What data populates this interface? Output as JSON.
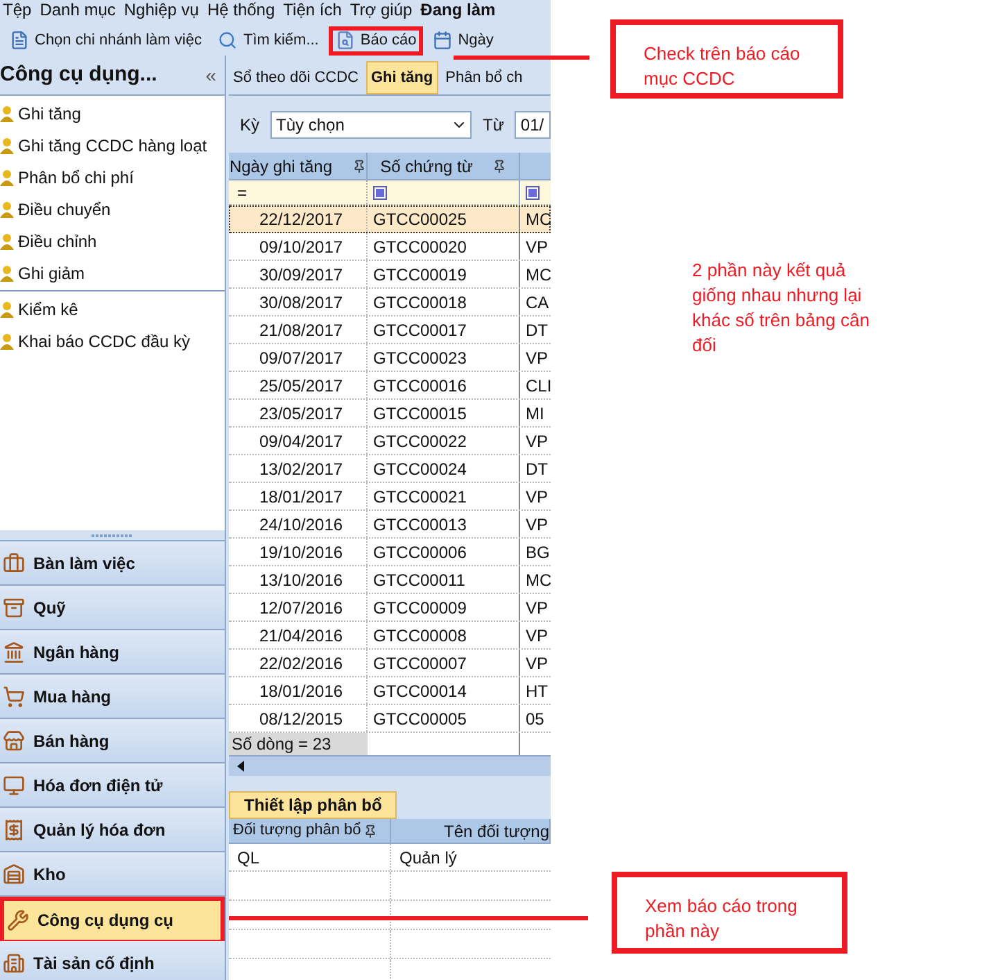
{
  "menu": [
    {
      "label": "Tệp",
      "bold": false
    },
    {
      "label": "Danh mục",
      "bold": false
    },
    {
      "label": "Nghiệp vụ",
      "bold": false
    },
    {
      "label": "Hệ thống",
      "bold": false
    },
    {
      "label": "Tiện ích",
      "bold": false
    },
    {
      "label": "Trợ giúp",
      "bold": false
    },
    {
      "label": "Đang làm",
      "bold": true
    }
  ],
  "toolbar": [
    {
      "label": "Chọn chi nhánh làm việc",
      "kind": "branch",
      "annotated": false
    },
    {
      "label": "Tìm kiếm...",
      "kind": "search",
      "annotated": false
    },
    {
      "label": "Báo cáo",
      "kind": "report",
      "annotated": true
    },
    {
      "label": "Ngày",
      "kind": "calendar",
      "annotated": false
    }
  ],
  "sidebar": {
    "title": "Công cụ dụng...",
    "collapse": "«",
    "groups": [
      [
        "Ghi tăng",
        "Ghi tăng CCDC hàng loạt",
        "Phân bổ chi phí",
        "Điều chuyển",
        "Điều chỉnh",
        "Ghi giảm"
      ],
      [
        "Kiểm kê",
        "Khai báo CCDC đầu kỳ"
      ]
    ]
  },
  "modules": [
    {
      "label": "Bàn làm việc",
      "selected": false,
      "annotated": false
    },
    {
      "label": "Quỹ",
      "selected": false,
      "annotated": false
    },
    {
      "label": "Ngân hàng",
      "selected": false,
      "annotated": false
    },
    {
      "label": "Mua hàng",
      "selected": false,
      "annotated": false
    },
    {
      "label": "Bán hàng",
      "selected": false,
      "annotated": false
    },
    {
      "label": "Hóa đơn điện tử",
      "selected": false,
      "annotated": false
    },
    {
      "label": "Quản lý hóa đơn",
      "selected": false,
      "annotated": false
    },
    {
      "label": "Kho",
      "selected": false,
      "annotated": false
    },
    {
      "label": "Công cụ dụng cụ",
      "selected": true,
      "annotated": true
    },
    {
      "label": "Tài sản cố định",
      "selected": false,
      "annotated": false
    }
  ],
  "tabs": [
    {
      "label": "Sổ theo dõi CCDC",
      "selected": false
    },
    {
      "label": "Ghi tăng",
      "selected": true
    },
    {
      "label": "Phân bổ ch",
      "selected": false
    }
  ],
  "filter": {
    "label": "Kỳ",
    "value": "Tùy chọn",
    "from_label": "Từ",
    "from_value": "01/"
  },
  "grid": {
    "columns": [
      "Ngày ghi tăng",
      "Số chứng từ"
    ],
    "filter_operator": "=",
    "footer": "Số dòng = 23",
    "rows": [
      {
        "cells": [
          "22/12/2017",
          "GTCC00025",
          "MC"
        ],
        "selected": true
      },
      {
        "cells": [
          "09/10/2017",
          "GTCC00020",
          "VP"
        ],
        "selected": false
      },
      {
        "cells": [
          "30/09/2017",
          "GTCC00019",
          "MC"
        ],
        "selected": false
      },
      {
        "cells": [
          "30/08/2017",
          "GTCC00018",
          "CA"
        ],
        "selected": false
      },
      {
        "cells": [
          "21/08/2017",
          "GTCC00017",
          "DT"
        ],
        "selected": false
      },
      {
        "cells": [
          "09/07/2017",
          "GTCC00023",
          "VP"
        ],
        "selected": false
      },
      {
        "cells": [
          "25/05/2017",
          "GTCC00016",
          "CLI"
        ],
        "selected": false
      },
      {
        "cells": [
          "23/05/2017",
          "GTCC00015",
          "MI"
        ],
        "selected": false
      },
      {
        "cells": [
          "09/04/2017",
          "GTCC00022",
          "VP"
        ],
        "selected": false
      },
      {
        "cells": [
          "13/02/2017",
          "GTCC00024",
          "DT"
        ],
        "selected": false
      },
      {
        "cells": [
          "18/01/2017",
          "GTCC00021",
          "VP"
        ],
        "selected": false
      },
      {
        "cells": [
          "24/10/2016",
          "GTCC00013",
          "VP"
        ],
        "selected": false
      },
      {
        "cells": [
          "19/10/2016",
          "GTCC00006",
          "BG"
        ],
        "selected": false
      },
      {
        "cells": [
          "13/10/2016",
          "GTCC00011",
          "MC"
        ],
        "selected": false
      },
      {
        "cells": [
          "12/07/2016",
          "GTCC00009",
          "VP"
        ],
        "selected": false
      },
      {
        "cells": [
          "21/04/2016",
          "GTCC00008",
          "VP"
        ],
        "selected": false
      },
      {
        "cells": [
          "22/02/2016",
          "GTCC00007",
          "VP"
        ],
        "selected": false
      },
      {
        "cells": [
          "18/01/2016",
          "GTCC00014",
          "HT"
        ],
        "selected": false
      },
      {
        "cells": [
          "08/12/2015",
          "GTCC00005",
          "05"
        ],
        "selected": false
      }
    ]
  },
  "allocation": {
    "tab": "Thiết lập phân bổ",
    "columns": [
      "Đối tượng phân bổ",
      "Tên đối tượng"
    ],
    "rows": [
      [
        "QL",
        "Quản lý"
      ]
    ]
  },
  "annotations": [
    {
      "kind": "callout",
      "text": "Check trên báo cáo mục CCDC"
    },
    {
      "kind": "note",
      "text": "2 phần này kết quả giống nhau nhưng lại khác số trên bảng cân đối"
    },
    {
      "kind": "callout",
      "text": "Xem báo cáo trong phần này"
    }
  ]
}
